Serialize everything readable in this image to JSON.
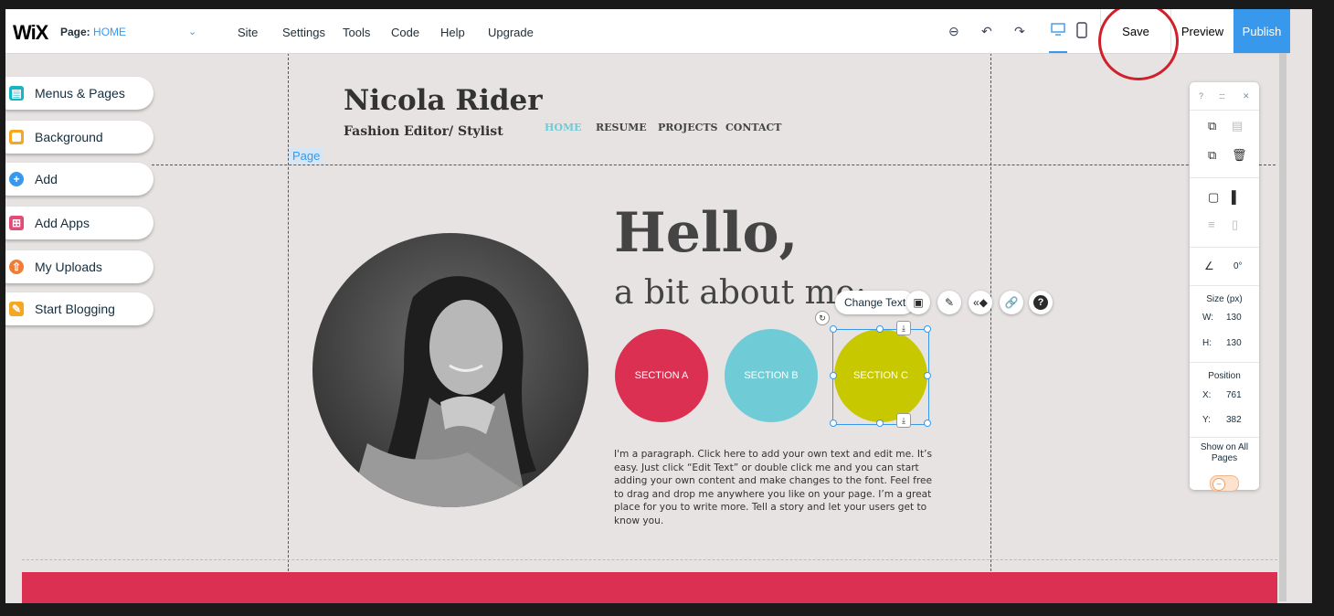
{
  "topbar": {
    "logo": "WiX",
    "page_label": "Page:",
    "page_value": "HOME",
    "menu": [
      "Site",
      "Settings",
      "Tools",
      "Code",
      "Help",
      "Upgrade"
    ],
    "save": "Save",
    "preview": "Preview",
    "publish": "Publish"
  },
  "sidebar": {
    "items": [
      {
        "label": "Menus & Pages",
        "color": "#18b4c6"
      },
      {
        "label": "Background",
        "color": "#f5a623"
      },
      {
        "label": "Add",
        "color": "#3899ec"
      },
      {
        "label": "Add Apps",
        "color": "#e34a76"
      },
      {
        "label": "My Uploads",
        "color": "#f07d35"
      },
      {
        "label": "Start Blogging",
        "color": "#f5a623"
      }
    ]
  },
  "site": {
    "title": "Nicola Rider",
    "subtitle": "Fashion Editor/ Stylist",
    "nav": [
      "HOME",
      "RESUME",
      "PROJECTS",
      "CONTACT"
    ],
    "page_tag": "Page",
    "hello": "Hello,",
    "about": "a bit about me:",
    "sections": [
      {
        "label": "SECTION A",
        "color": "#dc3052"
      },
      {
        "label": "SECTION B",
        "color": "#6fccd6"
      },
      {
        "label": "SECTION C",
        "color": "#c8c800"
      }
    ],
    "paragraph": "I'm a paragraph. Click here to add your own text and edit me. It’s easy. Just click “Edit Text” or double click me and you can start adding your own content and make changes to the font. Feel free to drag and drop me anywhere you like on your page. I’m a great place for you to write more. Tell a story and let your users get to know you."
  },
  "toolbar": {
    "change_text": "Change Text"
  },
  "panel": {
    "help": "?",
    "rotation": "0°",
    "size_label": "Size (px)",
    "w_label": "W:",
    "w_value": "130",
    "h_label": "H:",
    "h_value": "130",
    "position_label": "Position",
    "x_label": "X:",
    "x_value": "761",
    "y_label": "Y:",
    "y_value": "382",
    "show_all": "Show on All Pages"
  }
}
